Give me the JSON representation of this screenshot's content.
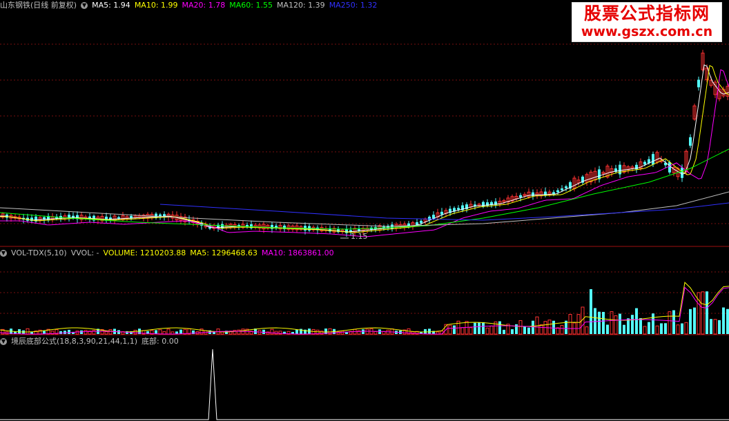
{
  "main_header": {
    "title": "山东钢铁(日线 前复权)",
    "ma5": "MA5: 1.94",
    "ma10": "MA10: 1.99",
    "ma20": "MA20: 1.78",
    "ma60": "MA60: 1.55",
    "ma120": "MA120: 1.39",
    "ma250": "MA250: 1.32"
  },
  "low_label": "1.15",
  "vol_header": {
    "title": "VOL-TDX(5,10)",
    "vvol": "VVOL: -",
    "volume": "VOLUME: 1210203.88",
    "ma5": "MA5: 1296468.63",
    "ma10": "MA10: 1863861.00"
  },
  "ind_header": {
    "title": "境辰底部公式(18,8,3,90,21,44,1,1)",
    "value": "底部: 0.00"
  },
  "watermark": {
    "line1": "股票公式指标网",
    "line2": "www.gszx.com.cn"
  },
  "colors": {
    "up": "#ff3232",
    "down": "#54fcfc",
    "grid": "#7a1010",
    "ma5": "#ffffff",
    "ma10": "#ffff00",
    "ma20": "#ff00ff",
    "ma60": "#00ff00",
    "ma120": "#c0c0c0",
    "ma250": "#3030ff"
  },
  "chart_data": {
    "type": "candlestick",
    "y_range_approx": [
      1.0,
      3.0
    ],
    "series": [
      {
        "name": "MA5",
        "last": 1.94
      },
      {
        "name": "MA10",
        "last": 1.99
      },
      {
        "name": "MA20",
        "last": 1.78
      },
      {
        "name": "MA60",
        "last": 1.55
      },
      {
        "name": "MA120",
        "last": 1.39
      },
      {
        "name": "MA250",
        "last": 1.32
      }
    ],
    "volume": {
      "last": 1210203.88,
      "ma5": 1296468.63,
      "ma10": 1863861.0
    },
    "indicator": {
      "name": "底部",
      "last": 0.0
    }
  }
}
